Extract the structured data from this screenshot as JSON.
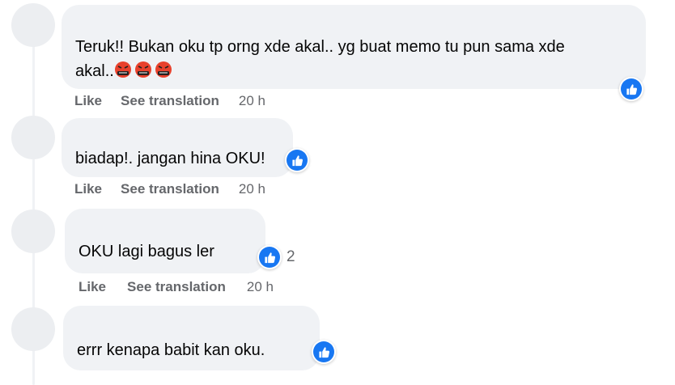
{
  "comments": [
    {
      "text": "Teruk!! Bukan oku tp orng xde akal.. yg buat memo tu pun sama xde",
      "text_line2": "akal..",
      "emojis": [
        "angry-face-with-symbols",
        "angry-face-with-symbols",
        "angry-face-with-symbols"
      ],
      "reaction": "like",
      "reaction_count": "",
      "like_label": "Like",
      "translate_label": "See translation",
      "time": "20 h"
    },
    {
      "text": "biadap!. jangan hina OKU!",
      "reaction": "like",
      "reaction_count": "",
      "like_label": "Like",
      "translate_label": "See translation",
      "time": "20 h"
    },
    {
      "text": "OKU lagi bagus ler",
      "reaction": "like",
      "reaction_count": "2",
      "like_label": "Like",
      "translate_label": "See translation",
      "time": "20 h"
    },
    {
      "text": "errr kenapa babit kan oku.",
      "reaction": "like",
      "reaction_count": ""
    }
  ],
  "colors": {
    "bubble_bg": "#f0f2f5",
    "like_blue": "#1877f2",
    "meta_gray": "#65676b",
    "text": "#050505"
  }
}
